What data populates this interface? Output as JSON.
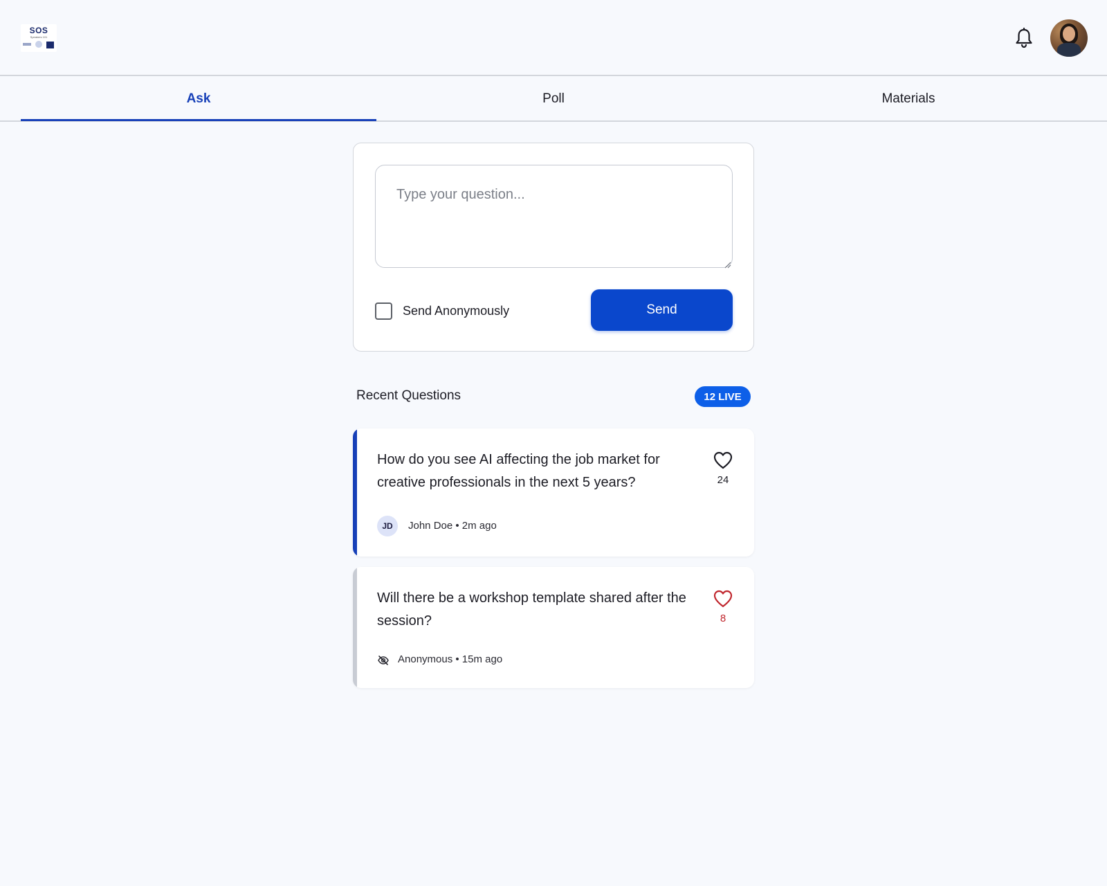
{
  "header": {
    "logo": {
      "name": "SOS",
      "sub": "Speakers 101"
    },
    "notifications_icon": "bell-icon",
    "avatar_icon": "user-avatar"
  },
  "tabs": [
    {
      "label": "Ask",
      "active": true
    },
    {
      "label": "Poll",
      "active": false
    },
    {
      "label": "Materials",
      "active": false
    }
  ],
  "composer": {
    "placeholder": "Type your question...",
    "value": "",
    "anonymous_label": "Send Anonymously",
    "anonymous_checked": false,
    "send_label": "Send"
  },
  "recent": {
    "title": "Recent Questions",
    "badge": "12 LIVE"
  },
  "questions": [
    {
      "text": "How do you see AI affecting the job market for creative professionals in the next 5 years?",
      "likes": "24",
      "liked": false,
      "author_initials": "JD",
      "meta": "John Doe • 2m ago",
      "accent": "#1740b8"
    },
    {
      "text": "Will there be a workshop template shared after the session?",
      "likes": "8",
      "liked": true,
      "author_icon": "eye-off-icon",
      "meta": "Anonymous • 15m ago",
      "accent": "#c8ccd4"
    }
  ],
  "colors": {
    "primary": "#0a47cc",
    "tab_active": "#1740b8",
    "badge": "#0d5fe8",
    "liked": "#c0262d",
    "background": "#f7f9fd"
  }
}
